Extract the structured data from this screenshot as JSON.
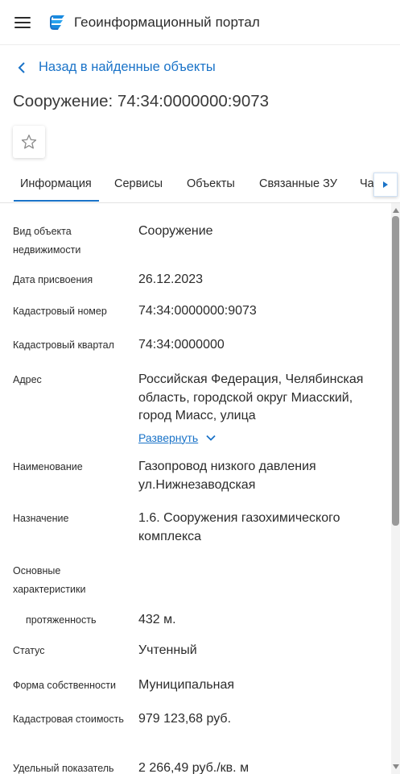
{
  "header": {
    "app_title": "Геоинформационный портал",
    "menu_icon": "hamburger-icon",
    "logo_icon": "portal-logo-icon",
    "accent_color": "#1a73c8"
  },
  "nav": {
    "back_label": "Назад в найденные объекты"
  },
  "page": {
    "title": "Сооружение: 74:34:0000000:9073"
  },
  "tabs": [
    {
      "label": "Информация",
      "active": true
    },
    {
      "label": "Сервисы",
      "active": false
    },
    {
      "label": "Объекты",
      "active": false
    },
    {
      "label": "Связанные ЗУ",
      "active": false
    },
    {
      "label": "Ча",
      "active": false
    }
  ],
  "details": {
    "object_type": {
      "label": "Вид объекта недвижимости",
      "value": "Сооружение"
    },
    "assign_date": {
      "label": "Дата присвоения",
      "value": "26.12.2023"
    },
    "cadastral_number": {
      "label": "Кадастровый номер",
      "value": "74:34:0000000:9073"
    },
    "cadastral_block": {
      "label": "Кадастровый квартал",
      "value": "74:34:0000000"
    },
    "address": {
      "label": "Адрес",
      "value": "Российская Федерация, Челябинская область, городской округ Миасский, город Миасс, улица",
      "expand_label": "Развернуть"
    },
    "name": {
      "label": "Наименование",
      "value": "Газопровод низкого давления ул.Нижнезаводская"
    },
    "purpose": {
      "label": "Назначение",
      "value": "1.6. Сооружения газохимического комплекса"
    },
    "main_characteristics": {
      "label": "Основные характеристики"
    },
    "length": {
      "label": "протяженность",
      "value": "432 м."
    },
    "status": {
      "label": "Статус",
      "value": "Учтенный"
    },
    "ownership": {
      "label": "Форма собственности",
      "value": "Муниципальная"
    },
    "cadastral_value": {
      "label": "Кадастровая стоимость",
      "value": "979 123,68 руб."
    },
    "specific_indicator": {
      "label": "Удельный показатель",
      "value": "2 266,49 руб./кв. м"
    }
  }
}
